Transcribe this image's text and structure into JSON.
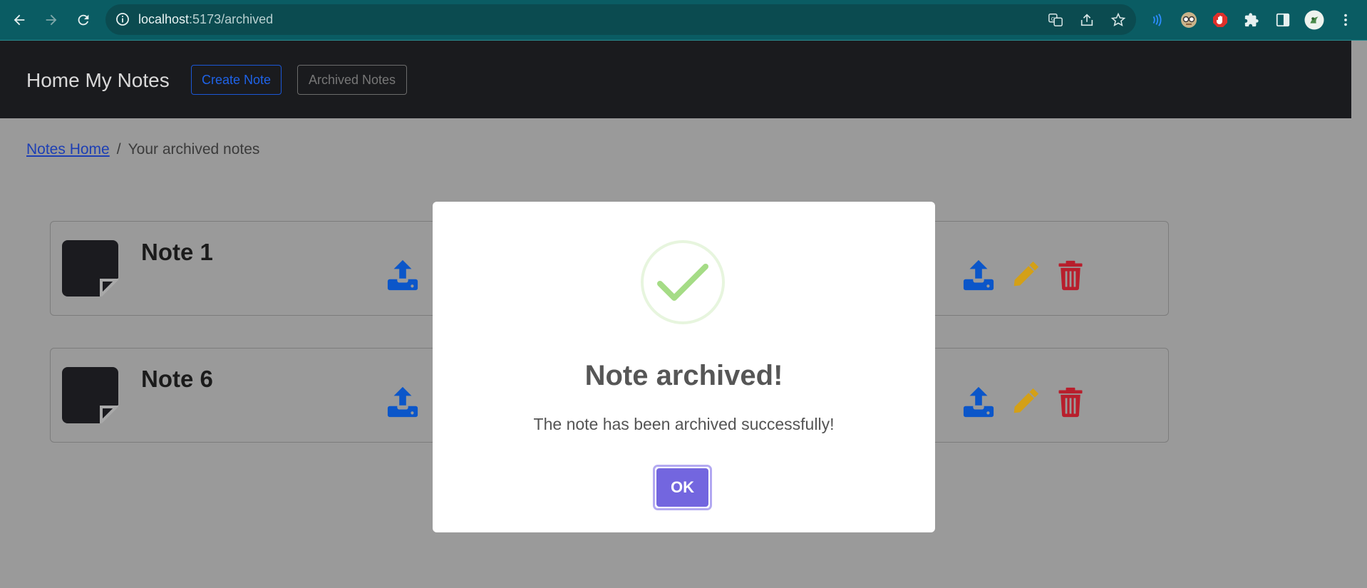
{
  "browser": {
    "url_host": "localhost",
    "url_path": ":5173/archived"
  },
  "navbar": {
    "brand": "Home My Notes",
    "create_label": "Create Note",
    "archived_label": "Archived Notes"
  },
  "breadcrumb": {
    "home_label": "Notes Home",
    "separator": "/",
    "current": "Your archived notes"
  },
  "notes": [
    {
      "title": "Note 1"
    },
    {
      "title": "Note 6"
    }
  ],
  "modal": {
    "title": "Note archived!",
    "text": "The note has been archived successfully!",
    "ok_label": "OK"
  },
  "colors": {
    "unarchive": "#0b56c9",
    "edit": "#d4a017",
    "delete": "#b81e2c",
    "ok_button": "#7366df",
    "success": "#a5dc86"
  }
}
